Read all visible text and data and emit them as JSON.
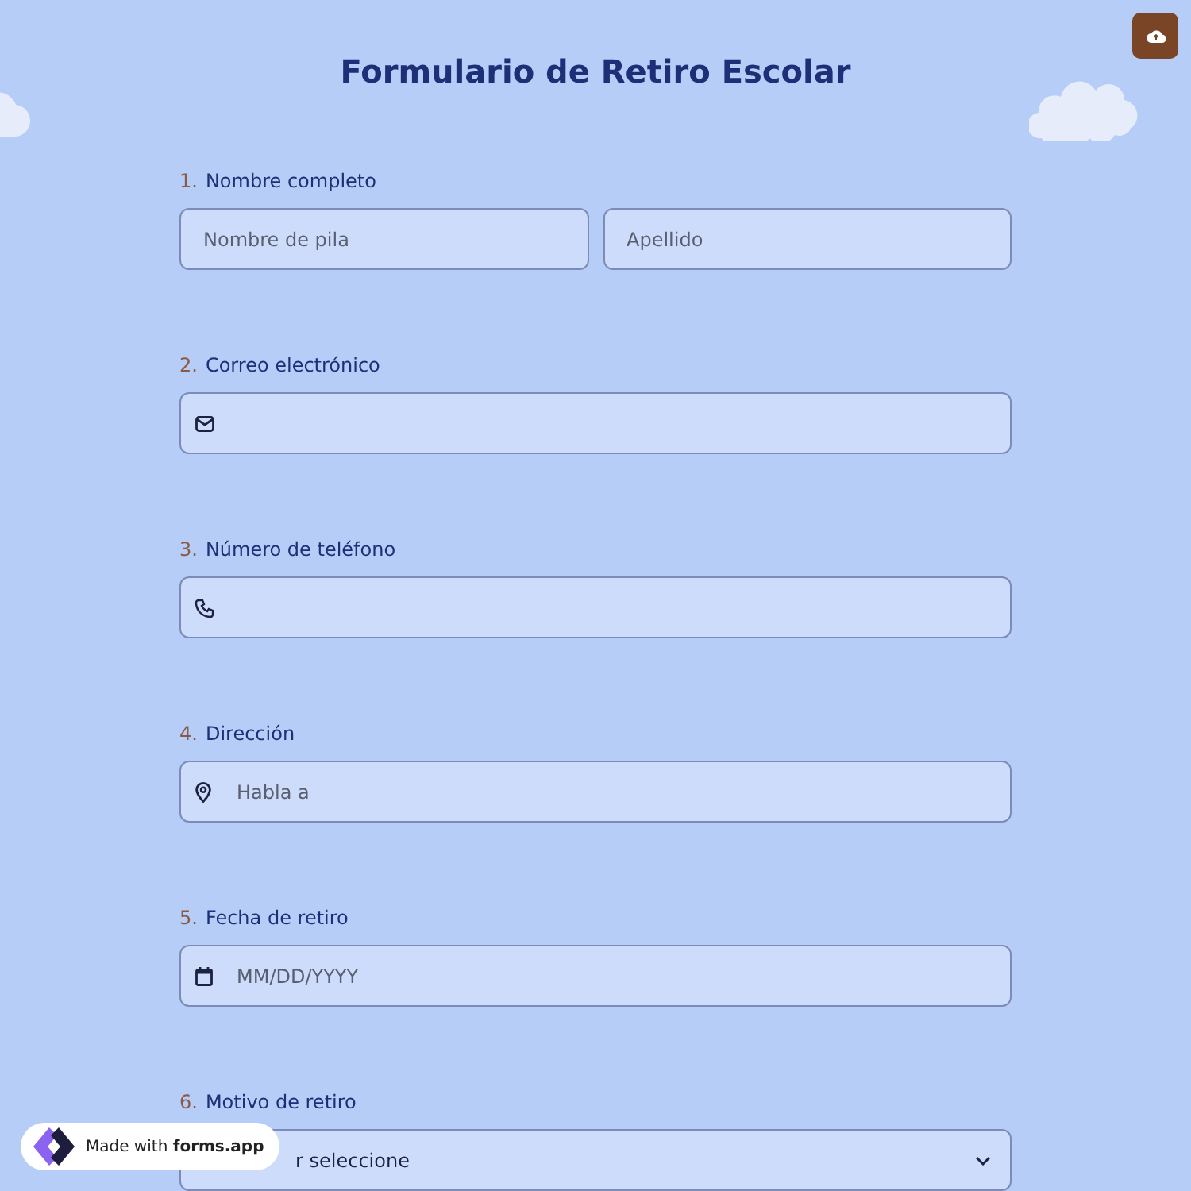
{
  "title": "Formulario de Retiro Escolar",
  "questions": [
    {
      "number": "1.",
      "label": "Nombre completo",
      "kind": "name",
      "placeholders": [
        "Nombre de pila",
        "Apellido"
      ]
    },
    {
      "number": "2.",
      "label": "Correo electrónico",
      "kind": "email"
    },
    {
      "number": "3.",
      "label": "Número de teléfono",
      "kind": "phone"
    },
    {
      "number": "4.",
      "label": "Dirección",
      "kind": "address",
      "placeholder": "Habla a"
    },
    {
      "number": "5.",
      "label": "Fecha de retiro",
      "kind": "date",
      "placeholder": "MM/DD/YYYY"
    },
    {
      "number": "6.",
      "label": "Motivo de retiro",
      "kind": "select",
      "value": "r seleccione"
    }
  ],
  "badge": {
    "prefix": "Made with",
    "brand": "forms.app"
  }
}
